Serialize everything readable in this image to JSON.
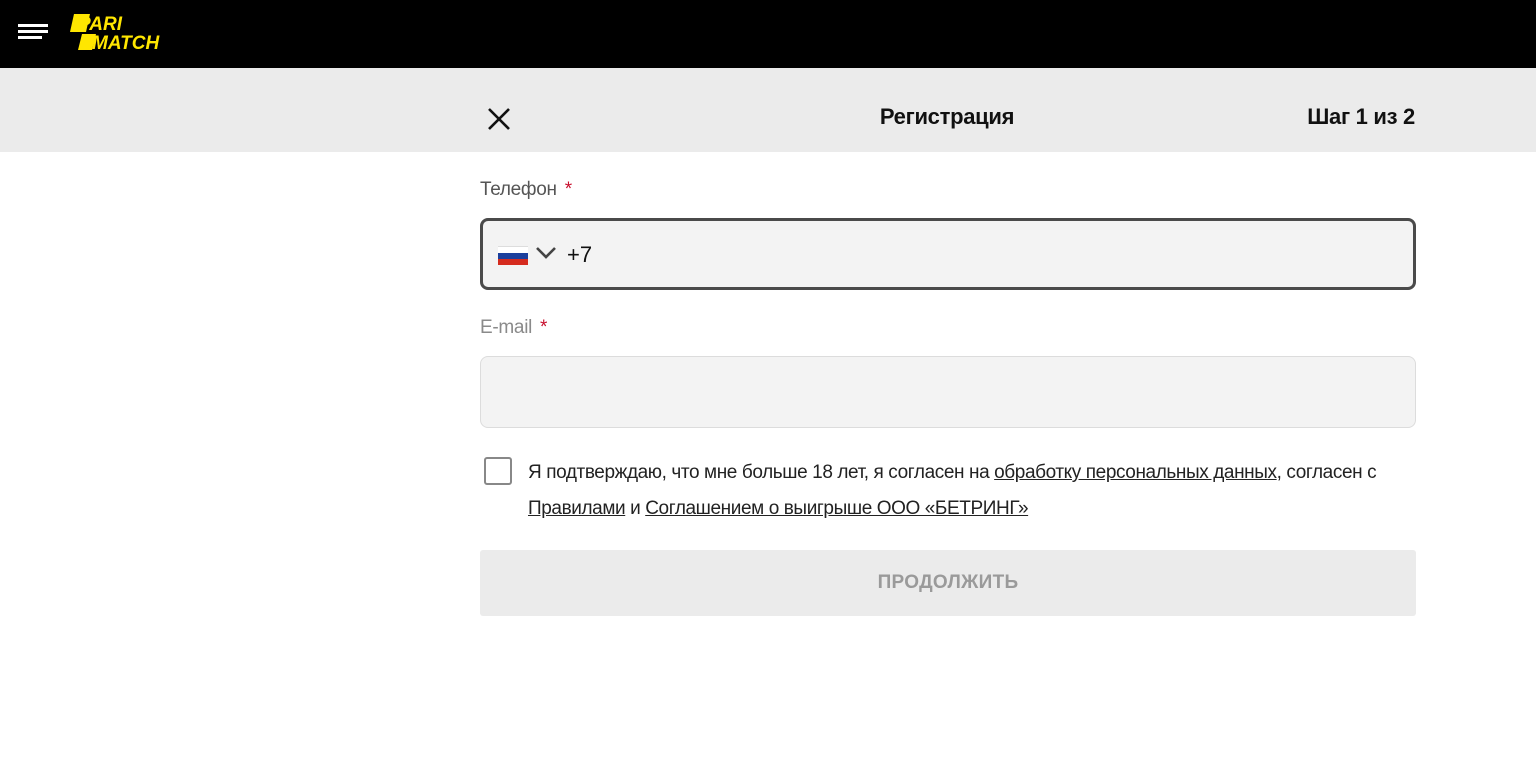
{
  "header": {
    "menu_icon": "hamburger-menu-icon",
    "logo_text": "PARI MATCH",
    "brand_color": "#ffe600"
  },
  "registration": {
    "title": "Регистрация",
    "step": "Шаг 1 из 2",
    "close_icon": "close-icon"
  },
  "phone": {
    "label": "Телефон",
    "required_mark": "*",
    "country_flag": "russia-flag-icon",
    "prefix": "+7",
    "value": ""
  },
  "email": {
    "label": "E-mail",
    "required_mark": "*",
    "value": ""
  },
  "consent": {
    "text_1": "Я подтверждаю, что мне больше 18 лет, я согласен на ",
    "link_personal_data": "обработку персональных данных",
    "text_2": ", согласен с ",
    "link_rules": "Правилами",
    "text_3": " и ",
    "link_agreement": "Соглашением о выигрыше ООО «БЕТРИНГ»",
    "checked": false
  },
  "actions": {
    "continue_label": "ПРОДОЛЖИТЬ"
  },
  "colors": {
    "topbar": "#000000",
    "subheader": "#ebebeb",
    "required": "#c8102e",
    "disabled_button": "#ebebeb"
  }
}
